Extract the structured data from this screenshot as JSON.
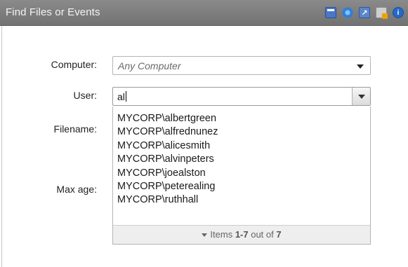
{
  "panel": {
    "title": "Find Files or Events"
  },
  "form": {
    "computer": {
      "label": "Computer:",
      "value": "Any Computer"
    },
    "user": {
      "label": "User:",
      "value": "al"
    },
    "filename": {
      "label": "Filename:"
    },
    "max_age": {
      "label": "Max age:"
    }
  },
  "user_suggestions": {
    "items": [
      "MYCORP\\albertgreen",
      "MYCORP\\alfrednunez",
      "MYCORP\\alicesmith",
      "MYCORP\\alvinpeters",
      "MYCORP\\joealston",
      "MYCORP\\peterealing",
      "MYCORP\\ruthhall"
    ],
    "pager": {
      "prefix": "Items ",
      "range": "1-7",
      "middle": " out of ",
      "total": "7"
    }
  },
  "icons": [
    "calendar-icon",
    "refresh-icon",
    "popout-icon",
    "note-icon",
    "info-icon"
  ],
  "colors": {
    "titlebar": "#7e7e7e",
    "title_text": "#f4f4f4"
  }
}
